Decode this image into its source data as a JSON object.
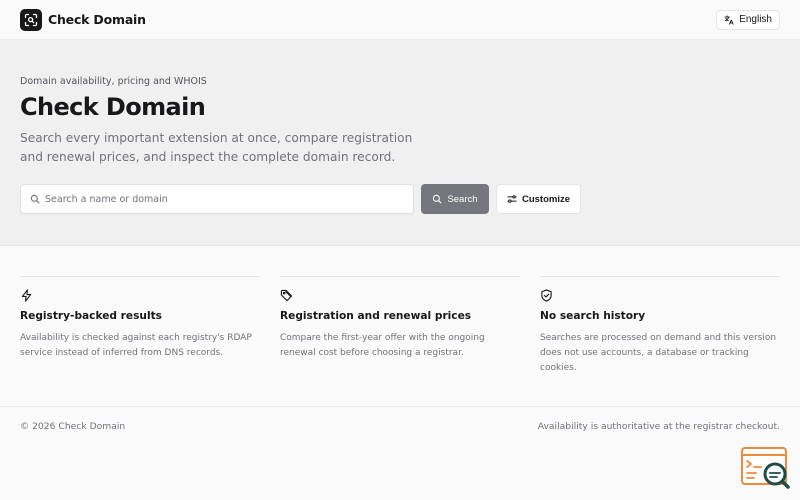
{
  "header": {
    "brand_name": "Check Domain",
    "language_label": "English"
  },
  "hero": {
    "eyebrow": "Domain availability, pricing and WHOIS",
    "title": "Check Domain",
    "subtitle": "Search every important extension at once, compare registration and renewal prices, and inspect the complete domain record.",
    "search_placeholder": "Search a name or domain",
    "search_value": "",
    "search_button": "Search",
    "customize_button": "Customize"
  },
  "features": [
    {
      "icon": "lightning-icon",
      "title": "Registry-backed results",
      "description": "Availability is checked against each registry's RDAP service instead of inferred from DNS records."
    },
    {
      "icon": "tag-icon",
      "title": "Registration and renewal prices",
      "description": "Compare the first-year offer with the ongoing renewal cost before choosing a registrar."
    },
    {
      "icon": "shield-check-icon",
      "title": "No search history",
      "description": "Searches are processed on demand and this version does not use accounts, a database or tracking cookies."
    }
  ],
  "footer": {
    "copyright": "© 2026 Check Domain",
    "note": "Availability is authoritative at the registrar checkout."
  },
  "colors": {
    "primary_dark": "#18181b",
    "muted_text": "#71717a",
    "search_button_bg": "#76767e",
    "widget_accent": "#f08a3c"
  }
}
